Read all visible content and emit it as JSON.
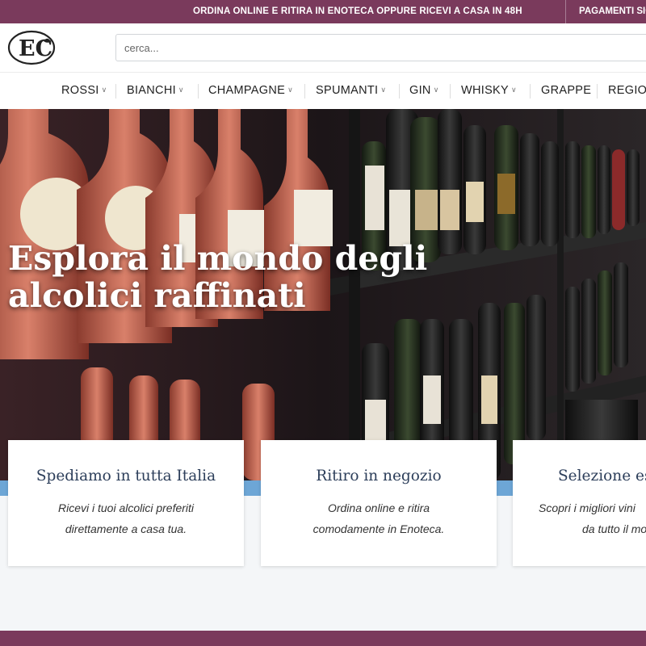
{
  "topbar": {
    "message": "ORDINA ONLINE E RITIRA IN ENOTECA OPPURE RICEVI A CASA IN 48H",
    "message2": "PAGAMENTI SICURI"
  },
  "header": {
    "logo_text": "EC",
    "search_placeholder": "cerca..."
  },
  "nav": {
    "items": [
      {
        "label": "ROSSI",
        "has_dropdown": true
      },
      {
        "label": "BIANCHI",
        "has_dropdown": true
      },
      {
        "label": "CHAMPAGNE",
        "has_dropdown": true
      },
      {
        "label": "SPUMANTI",
        "has_dropdown": true
      },
      {
        "label": "GIN",
        "has_dropdown": true
      },
      {
        "label": "WHISKY",
        "has_dropdown": true
      },
      {
        "label": "GRAPPE",
        "has_dropdown": false
      },
      {
        "label": "REGIONI",
        "has_dropdown": true
      }
    ]
  },
  "hero": {
    "title_line1": "Esplora il mondo degli",
    "title_line2": "alcolici raffinati"
  },
  "cards": [
    {
      "title": "Spediamo in tutta Italia",
      "line1": "Ricevi i tuoi alcolici preferiti",
      "line2": "direttamente a casa tua."
    },
    {
      "title": "Ritiro in negozio",
      "line1": "Ordina online e ritira",
      "line2": "comodamente in Enoteca."
    },
    {
      "title": "Selezione esclusiva",
      "line1": "Scopri i migliori vini",
      "line2": "da tutto il mondo."
    }
  ],
  "colors": {
    "brand": "#7a3a5c",
    "accent_band": "#6da6d6",
    "card_title": "#2c3e5a"
  }
}
